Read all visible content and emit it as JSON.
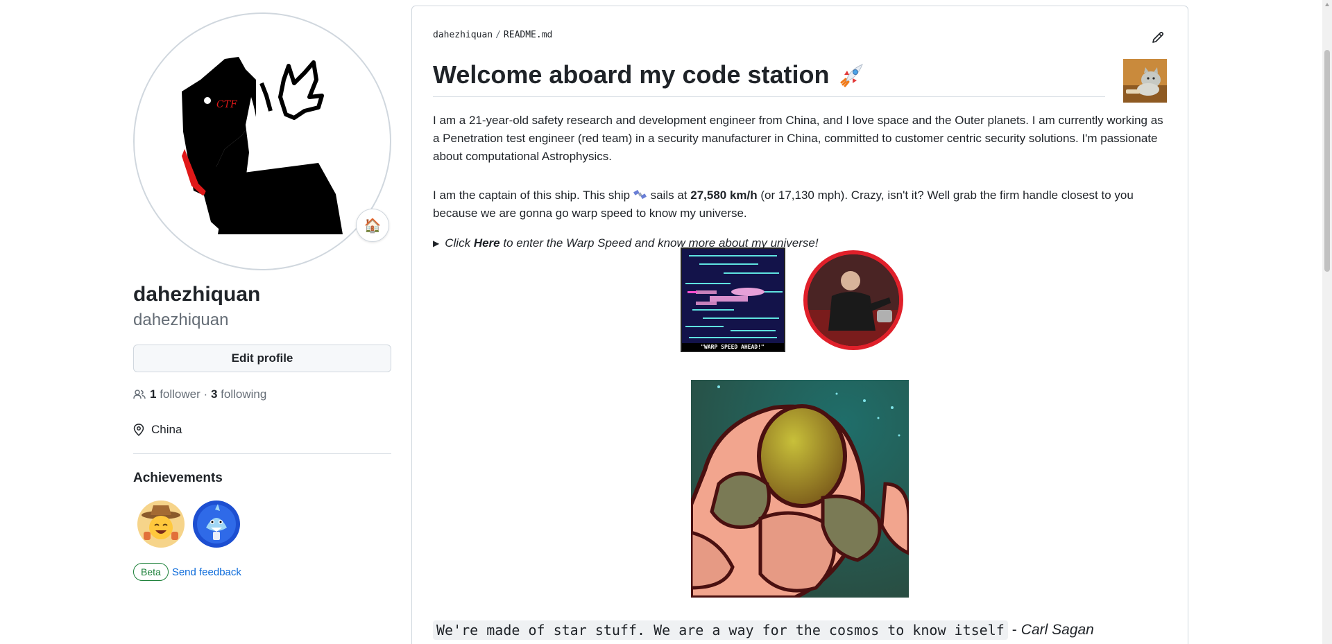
{
  "profile": {
    "full_name": "dahezhiquan",
    "username": "dahezhiquan",
    "status_emoji": "🏠",
    "edit_profile_label": "Edit profile",
    "followers_count": "1",
    "followers_label": "follower",
    "separator": "·",
    "following_count": "3",
    "following_label": "following",
    "location": "China",
    "avatar_text": "CTF"
  },
  "achievements": {
    "title": "Achievements",
    "badges": [
      "cowboy-achievement",
      "shark-achievement"
    ]
  },
  "beta": {
    "pill": "Beta",
    "feedback_link": "Send feedback"
  },
  "readme": {
    "owner": "dahezhiquan",
    "separator": "/",
    "file": "README.md",
    "title": "Welcome aboard my code station",
    "para1": "I am a 21-year-old safety research and development engineer from China, and I love space and the Outer planets. I am currently working as a Penetration test engineer (red team) in a security manufacturer in China, committed to customer centric security solutions. I'm passionate about computational Astrophysics.",
    "para2_a": "I am the captain of this ship. This ship",
    "para2_b": "sails at",
    "para2_speed": "27,580 km/h",
    "para2_c": "(or 17,130 mph). Crazy, isn't it? Well grab the firm handle closest to you because we are gonna go warp speed to know my universe.",
    "details_a": "Click",
    "details_here": "Here",
    "details_b": "to enter the Warp Speed and know more about my universe!",
    "warp_caption": "\"WARP SPEED AHEAD!\"",
    "quote_code": "We're made of star stuff. We are a way for the cosmos to know itself",
    "quote_dash": "-",
    "quote_author": "Carl Sagan"
  },
  "colors": {
    "accent_link": "#0969da",
    "beta_green": "#1a7f37",
    "captain_ring": "#e0202a"
  }
}
